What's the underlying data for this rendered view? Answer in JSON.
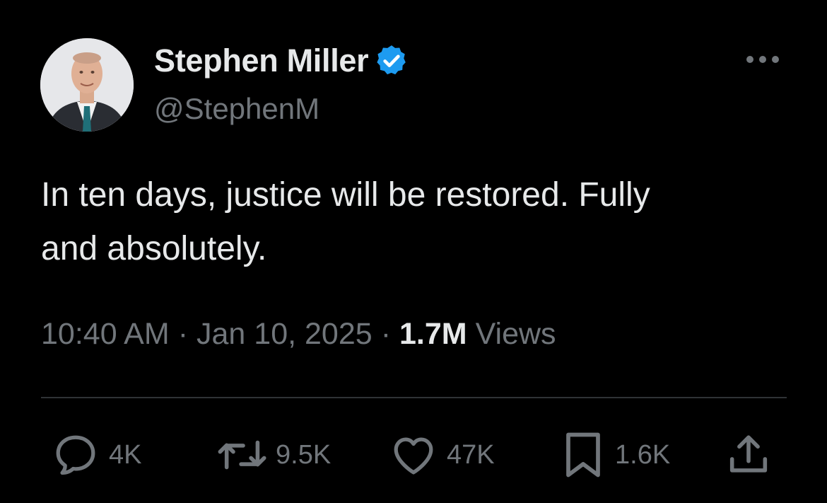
{
  "author": {
    "display_name": "Stephen Miller",
    "handle": "@StephenM",
    "verified_color": "#1d9bf0",
    "avatar_icon": "profile-photo"
  },
  "more_icon": "ellipsis-icon",
  "tweet": {
    "text": "In ten days, justice will be restored. Fully\nand absolutely."
  },
  "meta": {
    "time": "10:40 AM",
    "date": "Jan 10, 2025",
    "views_count": "1.7M",
    "views_label": "Views",
    "separator": "·"
  },
  "actions": {
    "replies": {
      "icon": "reply-icon",
      "count": "4K"
    },
    "reposts": {
      "icon": "repost-icon",
      "count": "9.5K"
    },
    "likes": {
      "icon": "heart-icon",
      "count": "47K"
    },
    "bookmarks": {
      "icon": "bookmark-icon",
      "count": "1.6K"
    },
    "share": {
      "icon": "share-icon"
    }
  },
  "colors": {
    "background": "#000000",
    "primary_text": "#e7e9ea",
    "secondary_text": "#71767b",
    "divider": "#2f3336"
  }
}
